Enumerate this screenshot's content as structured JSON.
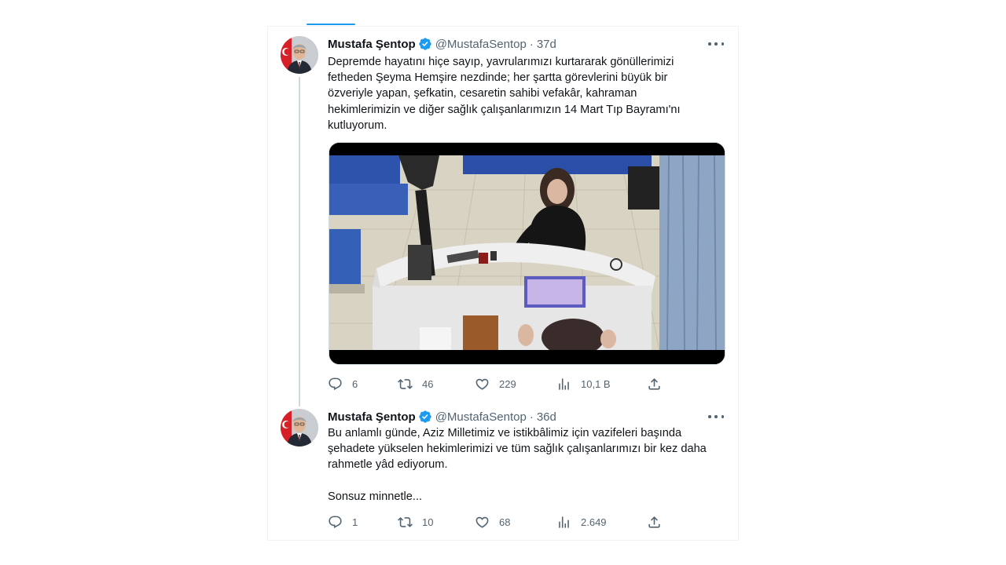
{
  "tweets": [
    {
      "name": "Mustafa Şentop",
      "handle": "@MustafaSentop",
      "separator": "·",
      "time": "37d",
      "text": "Depremde hayatını hiçe sayıp, yavrularımızı kurtararak gönüllerimizi\nfetheden Şeyma Hemşire nezdinde; her şartta görevlerini büyük bir\nözveriyle yapan, şefkatin, cesaretin sahibi vefakâr, kahraman\nhekimlerimizin ve diğer sağlık çalışanlarımızın 14 Mart Tıp Bayramı'nı\nkutluyorum.",
      "replies": "6",
      "retweets": "46",
      "likes": "229",
      "views": "10,1 B"
    },
    {
      "name": "Mustafa Şentop",
      "handle": "@MustafaSentop",
      "separator": "·",
      "time": "36d",
      "text": "Bu anlamlı günde, Aziz Milletimiz ve istikbâlimiz için vazifeleri başında\nşehadete yükselen hekimlerimizi ve tüm sağlık çalışanlarımızı bir kez daha\nrahmetle yâd ediyorum.",
      "text2": "Sonsuz minnetle...",
      "replies": "1",
      "retweets": "10",
      "likes": "68",
      "views": "2.649"
    }
  ],
  "icons": {
    "verified": "verified-badge-icon",
    "more": "more-icon",
    "reply": "reply-icon",
    "retweet": "retweet-icon",
    "like": "like-icon",
    "views": "views-icon",
    "share": "share-icon"
  },
  "colors": {
    "accent": "#1d9bf0",
    "text": "#0f1419",
    "secondary": "#536471",
    "border": "#eff3f4"
  }
}
